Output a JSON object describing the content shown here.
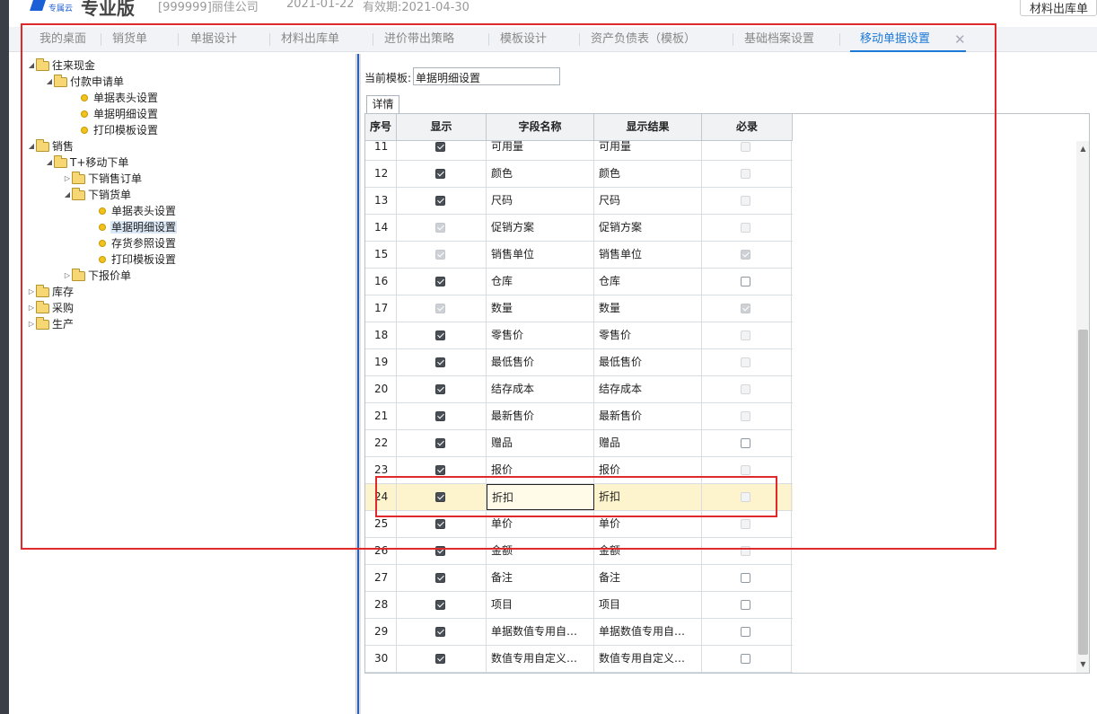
{
  "header": {
    "logo_sub": "专属云",
    "edition": "专业版",
    "company": "[999999]丽佳公司",
    "date": "2021-01-22",
    "validity": "有效期:2021-04-30",
    "top_button": "材料出库单"
  },
  "tabs": [
    {
      "label": "我的桌面"
    },
    {
      "label": "销货单"
    },
    {
      "label": "单据设计"
    },
    {
      "label": "材料出库单"
    },
    {
      "label": "进价带出策略"
    },
    {
      "label": "模板设计"
    },
    {
      "label": "资产负债表（模板）"
    },
    {
      "label": "基础档案设置"
    },
    {
      "label": "移动单据设置",
      "active": true
    }
  ],
  "tab_close": "✕",
  "tree": [
    {
      "label": "往来现金",
      "type": "folder",
      "expanded": true
    },
    {
      "label": "付款申请单",
      "type": "folder",
      "expanded": true
    },
    {
      "label": "单据表头设置",
      "type": "leaf"
    },
    {
      "label": "单据明细设置",
      "type": "leaf"
    },
    {
      "label": "打印模板设置",
      "type": "leaf"
    },
    {
      "label": "销售",
      "type": "folder",
      "expanded": true
    },
    {
      "label": "T+移动下单",
      "type": "folder",
      "expanded": true
    },
    {
      "label": "下销售订单",
      "type": "folder",
      "expanded": false
    },
    {
      "label": "下销货单",
      "type": "folder",
      "expanded": true
    },
    {
      "label": "单据表头设置",
      "type": "leaf"
    },
    {
      "label": "单据明细设置",
      "type": "leaf",
      "selected": true
    },
    {
      "label": "存货参照设置",
      "type": "leaf"
    },
    {
      "label": "打印模板设置",
      "type": "leaf"
    },
    {
      "label": "下报价单",
      "type": "folder",
      "expanded": false
    },
    {
      "label": "库存",
      "type": "folder",
      "expanded": false
    },
    {
      "label": "采购",
      "type": "folder",
      "expanded": false
    },
    {
      "label": "生产",
      "type": "folder",
      "expanded": false
    }
  ],
  "template": {
    "label": "当前模板:",
    "value": "单据明细设置"
  },
  "detail_tab": "详情",
  "columns": [
    "序号",
    "显示",
    "字段名称",
    "显示结果",
    "必录"
  ],
  "rows": [
    {
      "no": "11",
      "show": true,
      "show_disabled": false,
      "name": "可用量",
      "result": "可用量",
      "required": false,
      "req_disabled": true
    },
    {
      "no": "12",
      "show": true,
      "show_disabled": false,
      "name": "颜色",
      "result": "颜色",
      "required": false,
      "req_disabled": true
    },
    {
      "no": "13",
      "show": true,
      "show_disabled": false,
      "name": "尺码",
      "result": "尺码",
      "required": false,
      "req_disabled": true
    },
    {
      "no": "14",
      "show": true,
      "show_disabled": true,
      "name": "促销方案",
      "result": "促销方案",
      "required": false,
      "req_disabled": true
    },
    {
      "no": "15",
      "show": true,
      "show_disabled": true,
      "name": "销售单位",
      "result": "销售单位",
      "required": true,
      "req_disabled": true
    },
    {
      "no": "16",
      "show": true,
      "show_disabled": false,
      "name": "仓库",
      "result": "仓库",
      "required": false,
      "req_disabled": false
    },
    {
      "no": "17",
      "show": true,
      "show_disabled": true,
      "name": "数量",
      "result": "数量",
      "required": true,
      "req_disabled": true
    },
    {
      "no": "18",
      "show": true,
      "show_disabled": false,
      "name": "零售价",
      "result": "零售价",
      "required": false,
      "req_disabled": true
    },
    {
      "no": "19",
      "show": true,
      "show_disabled": false,
      "name": "最低售价",
      "result": "最低售价",
      "required": false,
      "req_disabled": true
    },
    {
      "no": "20",
      "show": true,
      "show_disabled": false,
      "name": "结存成本",
      "result": "结存成本",
      "required": false,
      "req_disabled": true
    },
    {
      "no": "21",
      "show": true,
      "show_disabled": false,
      "name": "最新售价",
      "result": "最新售价",
      "required": false,
      "req_disabled": true
    },
    {
      "no": "22",
      "show": true,
      "show_disabled": false,
      "name": "赠品",
      "result": "赠品",
      "required": false,
      "req_disabled": false
    },
    {
      "no": "23",
      "show": true,
      "show_disabled": false,
      "name": "报价",
      "result": "报价",
      "required": false,
      "req_disabled": true
    },
    {
      "no": "24",
      "show": true,
      "show_disabled": false,
      "name": "折扣",
      "result": "折扣",
      "required": false,
      "req_disabled": true,
      "highlight": true
    },
    {
      "no": "25",
      "show": true,
      "show_disabled": false,
      "name": "单价",
      "result": "单价",
      "required": false,
      "req_disabled": true
    },
    {
      "no": "26",
      "show": true,
      "show_disabled": false,
      "name": "金额",
      "result": "金额",
      "required": false,
      "req_disabled": true
    },
    {
      "no": "27",
      "show": true,
      "show_disabled": false,
      "name": "备注",
      "result": "备注",
      "required": false,
      "req_disabled": false
    },
    {
      "no": "28",
      "show": true,
      "show_disabled": false,
      "name": "项目",
      "result": "项目",
      "required": false,
      "req_disabled": false
    },
    {
      "no": "29",
      "show": true,
      "show_disabled": false,
      "name": "单据数值专用自…",
      "result": "单据数值专用自…",
      "required": false,
      "req_disabled": false
    },
    {
      "no": "30",
      "show": true,
      "show_disabled": false,
      "name": "数值专用自定义…",
      "result": "数值专用自定义…",
      "required": false,
      "req_disabled": false
    }
  ],
  "annotation_color": "#e0292a",
  "accent_color": "#1e7ad8"
}
